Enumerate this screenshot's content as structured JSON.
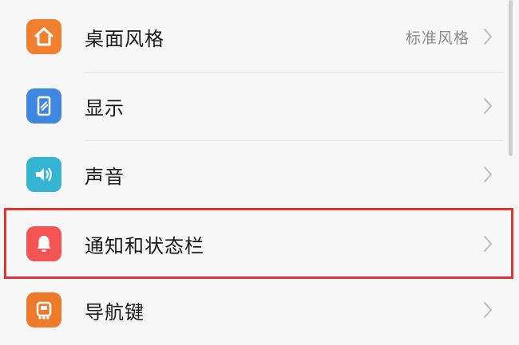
{
  "settings": {
    "items": [
      {
        "label": "桌面风格",
        "value": "标准风格",
        "icon": "home-icon",
        "icon_color": "#f0802f"
      },
      {
        "label": "显示",
        "value": "",
        "icon": "phone-display-icon",
        "icon_color": "#3f86e0"
      },
      {
        "label": "声音",
        "value": "",
        "icon": "speaker-icon",
        "icon_color": "#34b6d3"
      },
      {
        "label": "通知和状态栏",
        "value": "",
        "icon": "bell-icon",
        "icon_color": "#f45454",
        "highlighted": true
      },
      {
        "label": "导航键",
        "value": "",
        "icon": "navigation-key-icon",
        "icon_color": "#f07a2b"
      }
    ]
  },
  "colors": {
    "highlight_border": "#e4322f",
    "background": "#f7f7f7"
  }
}
